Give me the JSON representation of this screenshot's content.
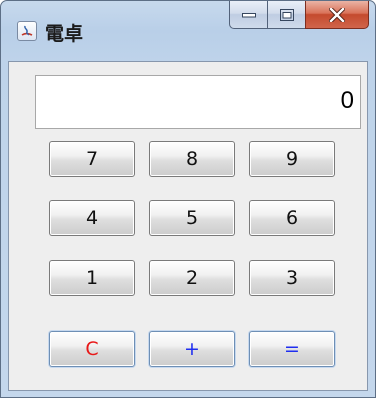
{
  "window": {
    "title": "電卓",
    "app_icon": "calculator-app-icon",
    "caption_buttons": {
      "minimize": "minimize-icon",
      "maximize": "maximize-icon",
      "close": "close-icon"
    }
  },
  "display": {
    "value": "0"
  },
  "keys": {
    "row1": [
      "7",
      "8",
      "9"
    ],
    "row2": [
      "4",
      "5",
      "6"
    ],
    "row3": [
      "1",
      "2",
      "3"
    ],
    "row4": [
      "C",
      "+",
      "="
    ]
  },
  "colors": {
    "clear_key_text": "#e81818",
    "operator_key_text": "#1f2ef0"
  }
}
